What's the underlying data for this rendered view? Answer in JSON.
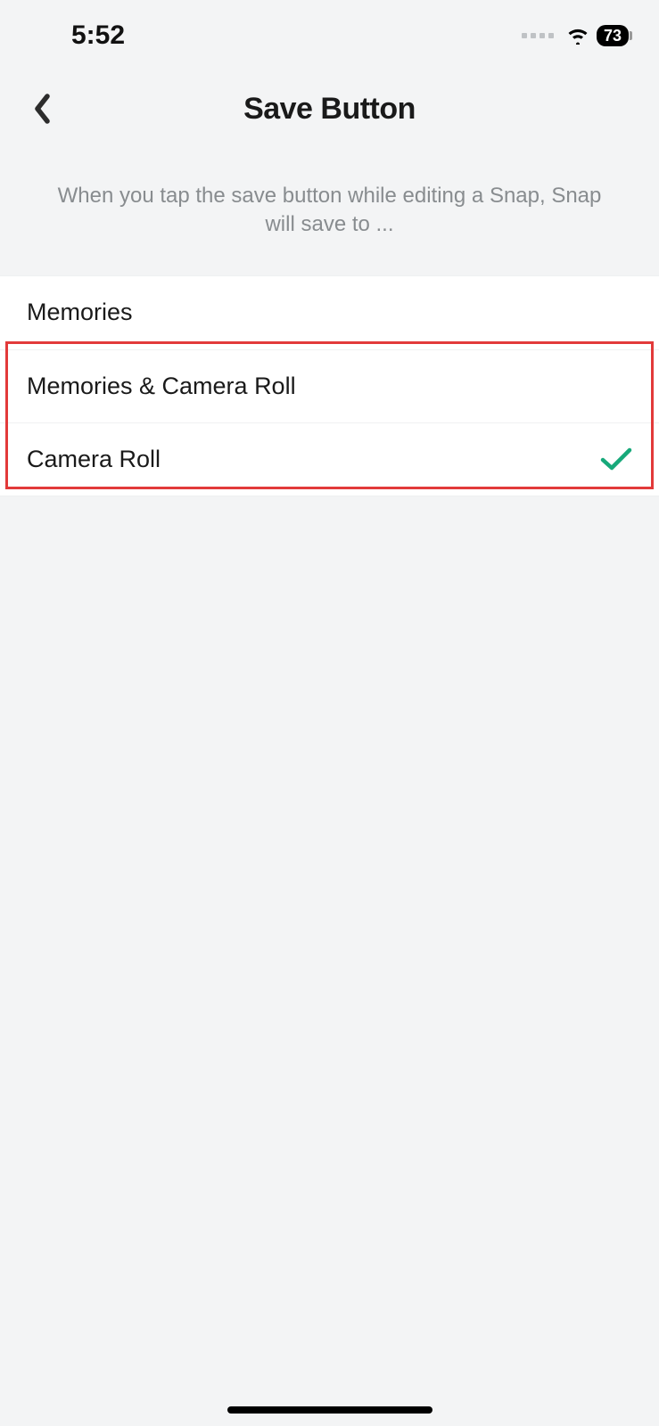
{
  "status_bar": {
    "time": "5:52",
    "battery": "73"
  },
  "header": {
    "title": "Save Button"
  },
  "description": "When you tap the save button while editing a Snap, Snap will save to ...",
  "options": [
    {
      "label": "Memories",
      "selected": false
    },
    {
      "label": "Memories & Camera Roll",
      "selected": false
    },
    {
      "label": "Camera Roll",
      "selected": true
    }
  ]
}
